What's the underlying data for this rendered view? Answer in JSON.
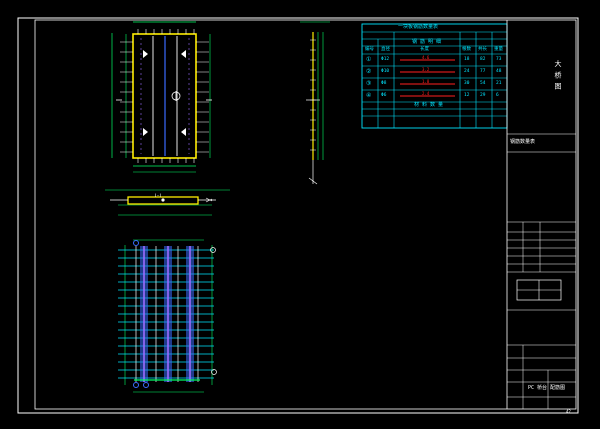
{
  "drawing": {
    "vertical_title": "大 桥 图",
    "section_label": "Ⅰ-Ⅰ",
    "bottom_title": "PC 桥台 配筋图",
    "panel_note": "钢筋数量表",
    "sheet_small": "42"
  },
  "table": {
    "header_title": "一块板钢筋数量表",
    "sub_title": "钢 筋 明 细",
    "footer_title": "材 料 数 量",
    "col_headers": [
      "编号",
      "直径",
      "长度",
      "根数",
      "共长",
      "重量"
    ],
    "rows": [
      {
        "id": "①",
        "d": "Φ12",
        "len": "4.6",
        "n": "18",
        "tot": "82",
        "w": "73"
      },
      {
        "id": "②",
        "d": "Φ10",
        "len": "3.2",
        "n": "24",
        "tot": "77",
        "w": "48"
      },
      {
        "id": "③",
        "d": "Φ8",
        "len": "1.8",
        "n": "30",
        "tot": "54",
        "w": "21"
      },
      {
        "id": "④",
        "d": "Φ6",
        "len": "2.4",
        "n": "12",
        "tot": "29",
        "w": "6"
      }
    ]
  },
  "colors": {
    "frame": "#ffffff",
    "cyan": "#00e5ff",
    "yellow": "#ffee00",
    "green": "#00ff66",
    "blue": "#3b6cff",
    "purple": "#9b6cff",
    "red": "#ff2020"
  }
}
